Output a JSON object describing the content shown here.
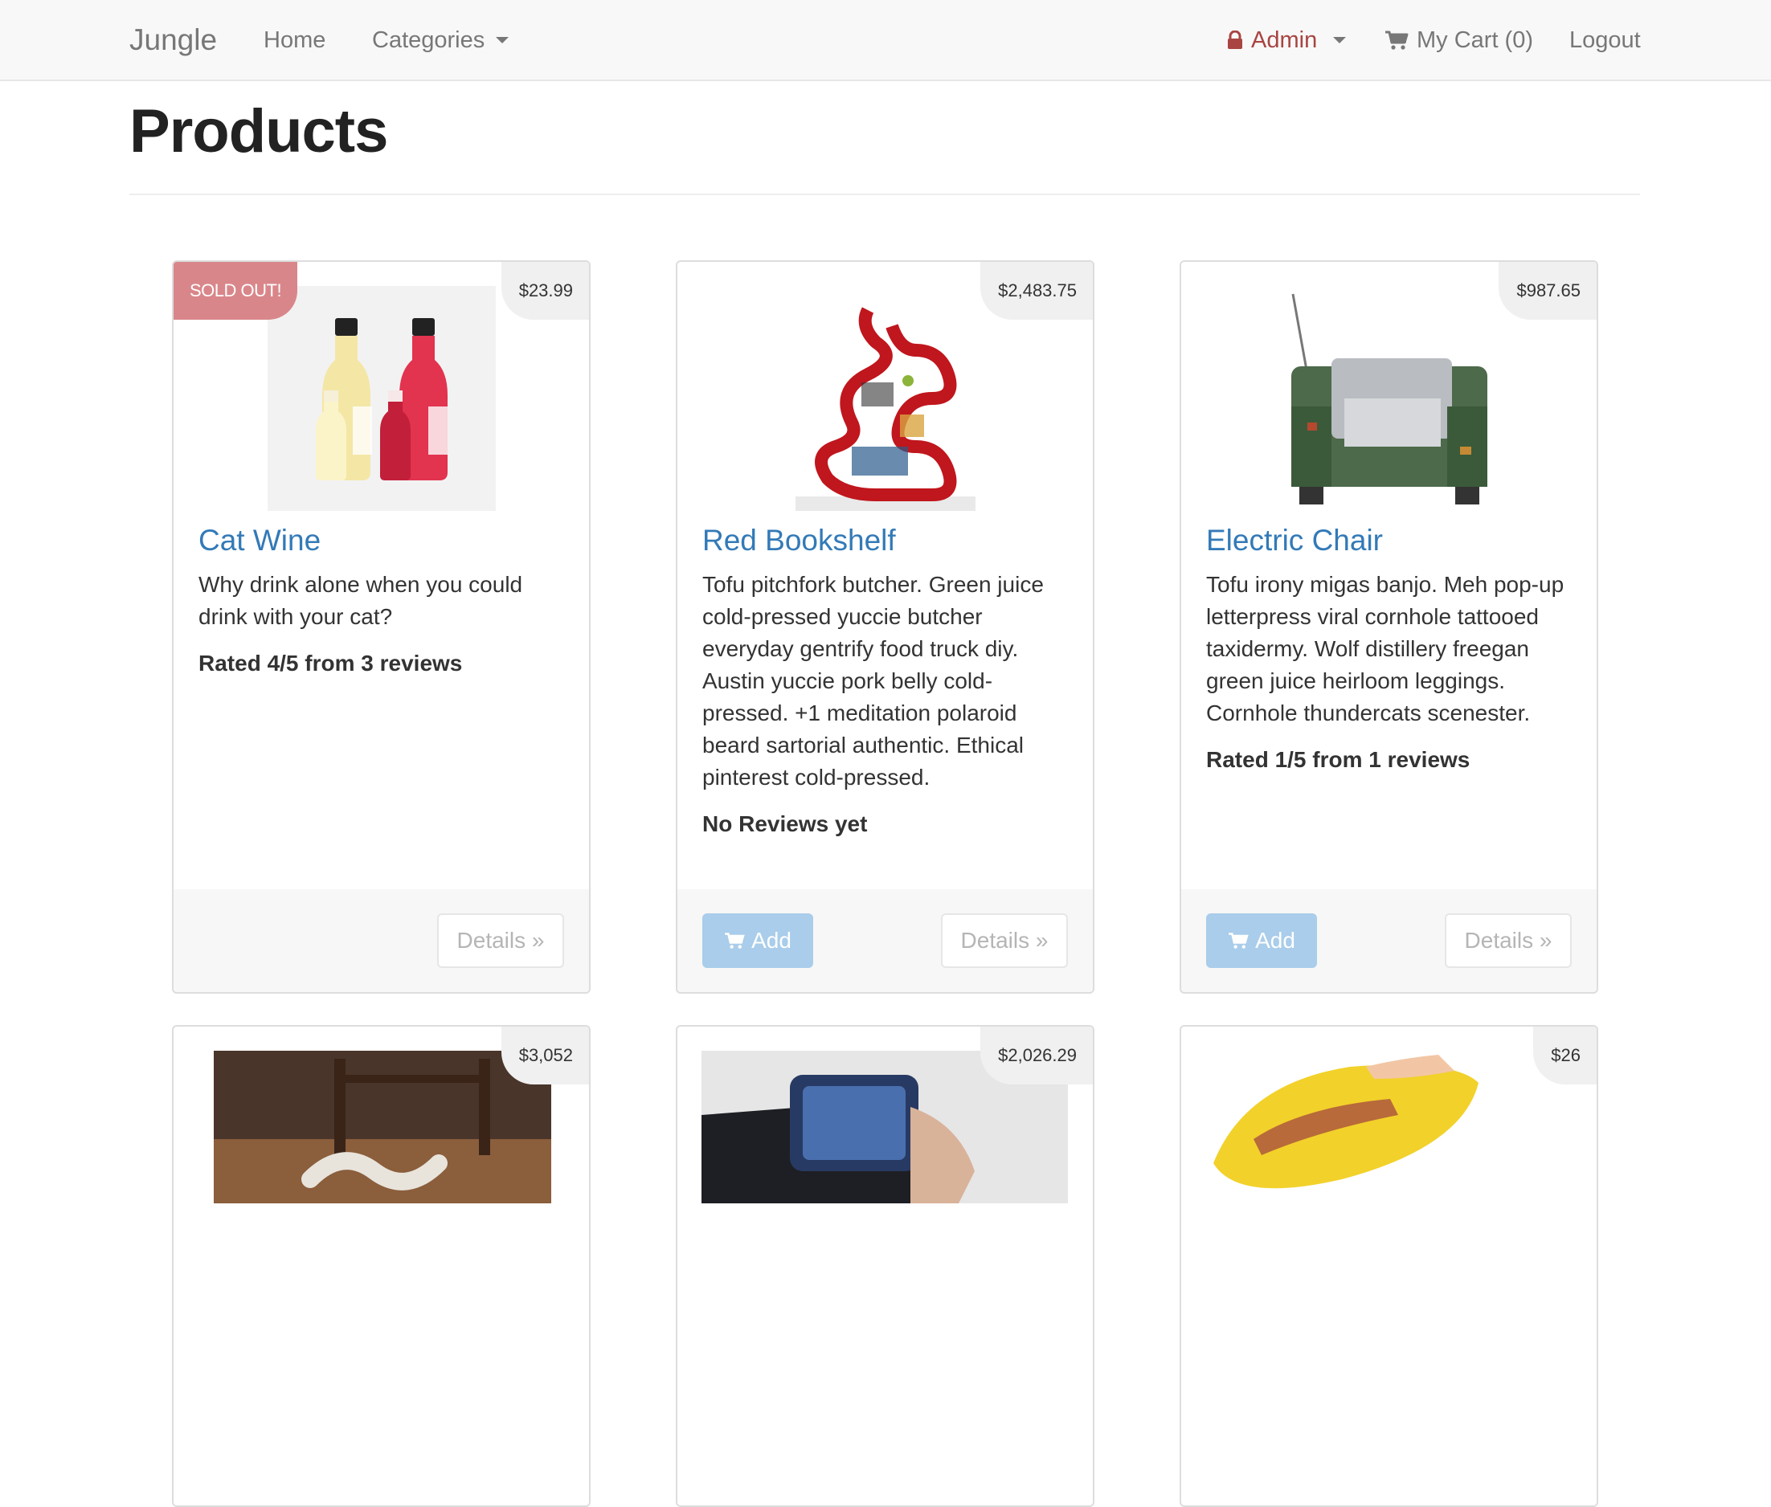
{
  "navbar": {
    "brand": "Jungle",
    "home": "Home",
    "categories": "Categories",
    "admin": "Admin",
    "cart": "My Cart (0)",
    "logout": "Logout"
  },
  "page": {
    "title": "Products"
  },
  "products": [
    {
      "price": "$23.99",
      "badge": "SOLD OUT!",
      "name": "Cat Wine",
      "description": "Why drink alone when you could drink with your cat?",
      "rating": "Rated 4/5 from 3 reviews",
      "details_label": "Details »",
      "image": "wine-bottles-image"
    },
    {
      "price": "$2,483.75",
      "name": "Red Bookshelf",
      "description": "Tofu pitchfork butcher. Green juice cold-pressed yuccie butcher everyday gentrify food truck diy. Austin yuccie pork belly cold-pressed. +1 meditation polaroid beard sartorial authentic. Ethical pinterest cold-pressed.",
      "rating": "No Reviews yet",
      "add_label": "Add",
      "details_label": "Details »",
      "image": "red-bookshelf-image"
    },
    {
      "price": "$987.65",
      "name": "Electric Chair",
      "description": "Tofu irony migas banjo. Meh pop-up letterpress viral cornhole tattooed taxidermy. Wolf distillery freegan green juice heirloom leggings. Cornhole thundercats scenester.",
      "rating": "Rated 1/5 from 1 reviews",
      "add_label": "Add",
      "details_label": "Details »",
      "image": "electric-chair-image"
    },
    {
      "price": "$3,052",
      "image": "snake-bed-image"
    },
    {
      "price": "$2,026.29",
      "image": "wrist-device-image"
    },
    {
      "price": "$26",
      "image": "hotdog-slicer-image"
    }
  ],
  "colors": {
    "link": "#337ab7",
    "admin": "#a94442",
    "soldout": "#d9868a",
    "add_button": "#a9cdea",
    "navbar_bg": "#f8f8f8"
  }
}
